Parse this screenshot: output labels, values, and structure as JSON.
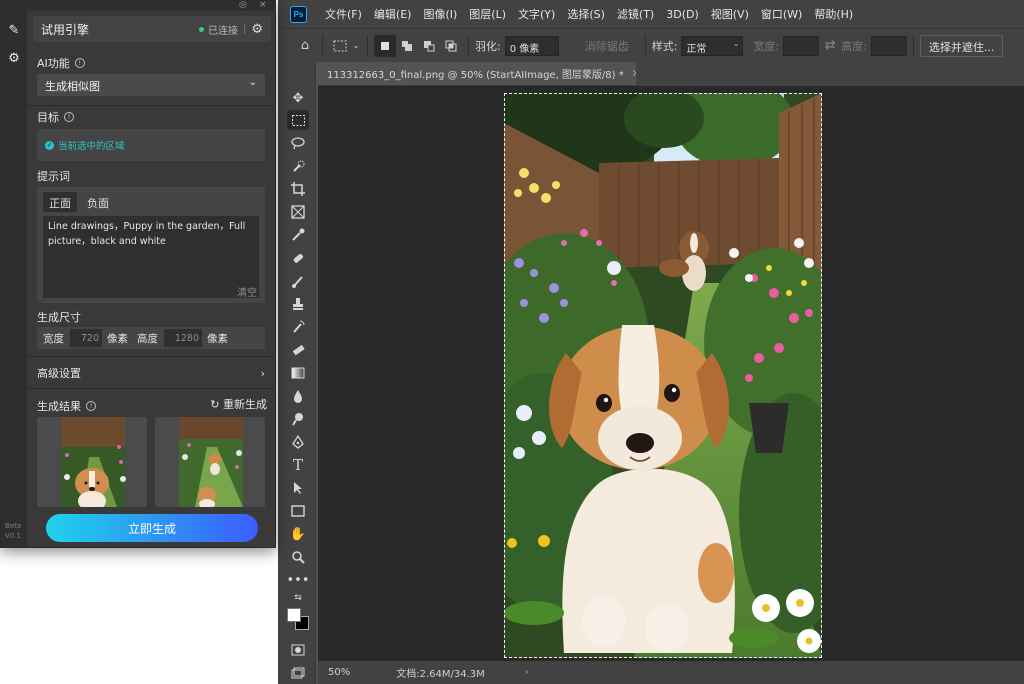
{
  "app": {
    "logo_text": "Ps",
    "menu": [
      "文件(F)",
      "编辑(E)",
      "图像(I)",
      "图层(L)",
      "文字(Y)",
      "选择(S)",
      "滤镜(T)",
      "3D(D)",
      "视图(V)",
      "窗口(W)",
      "帮助(H)"
    ]
  },
  "options_bar": {
    "feather_label": "羽化:",
    "feather_value": "0 像素",
    "antialias_label": "消除锯齿",
    "style_label": "样式:",
    "style_value": "正常",
    "width_label": "宽度:",
    "height_label": "高度:",
    "select_mask_label": "选择并遮住..."
  },
  "document": {
    "tab_title": "113312663_0_final.png @ 50% (StartAIImage, 图层蒙版/8) *",
    "close_glyph": "×",
    "zoom": "50%",
    "doc_size": "文档:2.64M/34.3M",
    "nav_arrow": "›"
  },
  "tools": [
    "move-tool",
    "marquee-tool",
    "lasso-tool",
    "quick-select-tool",
    "crop-tool",
    "frame-tool",
    "eyedropper-tool",
    "healing-brush-tool",
    "brush-tool",
    "stamp-tool",
    "history-brush-tool",
    "eraser-tool",
    "gradient-tool",
    "blur-tool",
    "dodge-tool",
    "pen-tool",
    "type-tool",
    "path-select-tool",
    "rectangle-tool",
    "hand-tool",
    "zoom-tool",
    "more-tools",
    "swap-colors",
    "foreground-background-colors",
    "quick-mask",
    "screen-mode"
  ],
  "panel": {
    "engine_name": "试用引擎",
    "status": "已连接",
    "separator": "|",
    "ai_function_label": "AI功能",
    "ai_function_value": "生成相似图",
    "target_label": "目标",
    "target_value": "当前选中的区域",
    "prompt_label": "提示词",
    "tab_positive": "正面",
    "tab_negative": "负面",
    "prompt_text": "Line drawings，Puppy in the garden，Full picture，black and white",
    "clear_label": "清空",
    "size_label": "生成尺寸",
    "width_label": "宽度",
    "width_value": "720",
    "height_label": "高度",
    "height_value": "1280",
    "unit_label": "像素",
    "advanced_label": "高级设置",
    "results_label": "生成结果",
    "regenerate_label": "重新生成",
    "generate_button": "立即生成",
    "version_line1": "Beta",
    "version_line2": "V0.1"
  },
  "colors": {
    "accent_gradient_start": "#1fd3ea",
    "accent_gradient_end": "#3b5cff",
    "status_green": "#35d07a",
    "target_cyan": "#2ec4c4",
    "ps_blue": "#31a8ff"
  }
}
